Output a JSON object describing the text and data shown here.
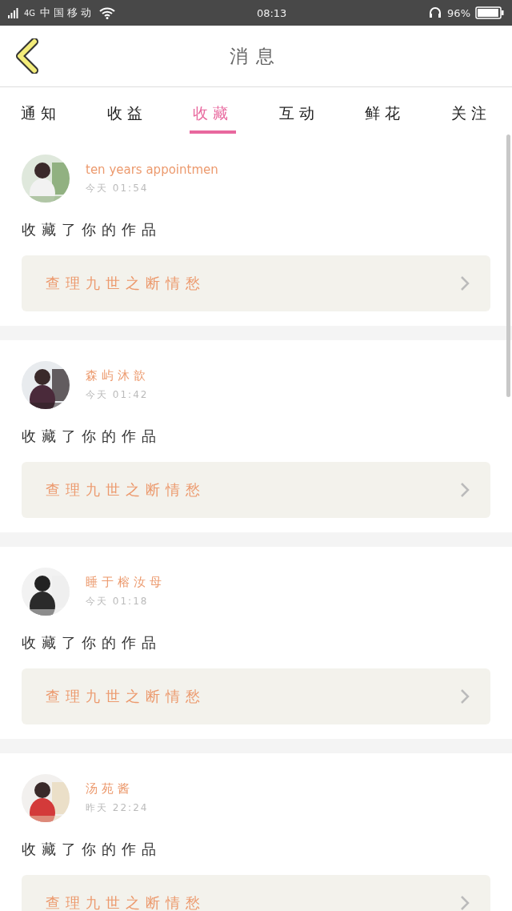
{
  "status_bar": {
    "network": "4G",
    "carrier": "中国移动",
    "time": "08:13",
    "battery": "96%"
  },
  "header": {
    "title": "消息"
  },
  "tabs": [
    {
      "label": "通知",
      "selected": false
    },
    {
      "label": "收益",
      "selected": false
    },
    {
      "label": "收藏",
      "selected": true
    },
    {
      "label": "互动",
      "selected": false
    },
    {
      "label": "鲜花",
      "selected": false
    },
    {
      "label": "关注",
      "selected": false
    }
  ],
  "messages": [
    {
      "name": "ten years appointmen",
      "time": "今天 01:54",
      "action": "收藏了你的作品",
      "work": "查理九世之断情愁"
    },
    {
      "name": "森屿沐歆",
      "time": "今天 01:42",
      "action": "收藏了你的作品",
      "work": "查理九世之断情愁"
    },
    {
      "name": "睡于榕汝母",
      "time": "今天 01:18",
      "action": "收藏了你的作品",
      "work": "查理九世之断情愁"
    },
    {
      "name": "汤苑酱",
      "time": "昨天 22:24",
      "action": "收藏了你的作品",
      "work": "查理九世之断情愁"
    }
  ]
}
